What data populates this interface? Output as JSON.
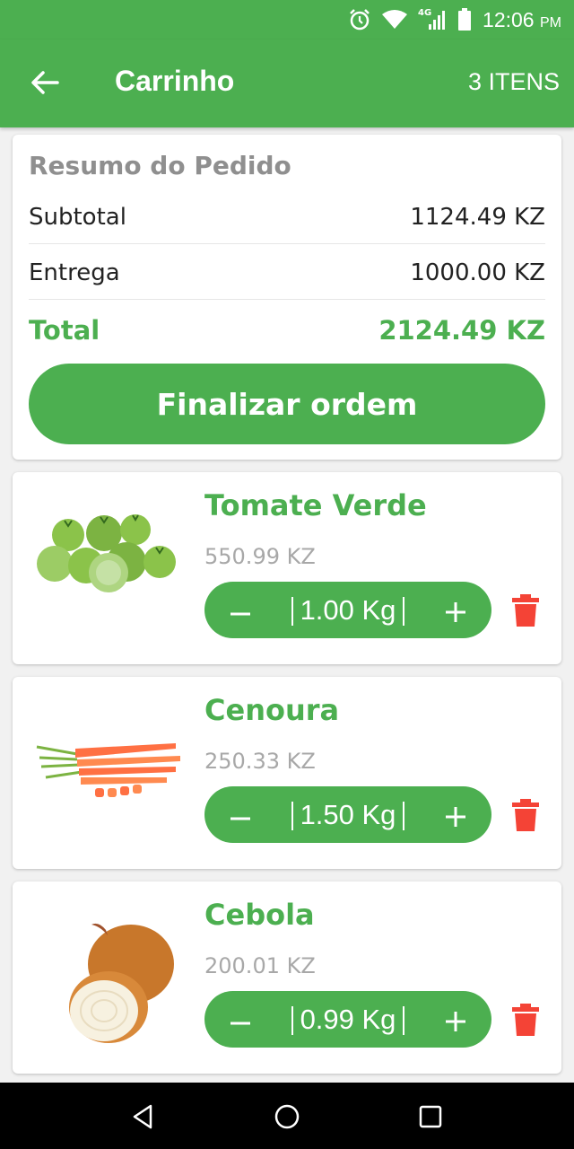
{
  "status_bar": {
    "time": "12:06",
    "ampm": "PM",
    "network": "4G"
  },
  "header": {
    "title": "Carrinho",
    "item_count": "3 ITENS"
  },
  "summary": {
    "title": "Resumo do Pedido",
    "subtotal_label": "Subtotal",
    "subtotal_value": "1124.49 KZ",
    "delivery_label": "Entrega",
    "delivery_value": "1000.00 KZ",
    "total_label": "Total",
    "total_value": "2124.49 KZ",
    "checkout_label": "Finalizar ordem"
  },
  "items": [
    {
      "name": "Tomate Verde",
      "price": "550.99 KZ",
      "quantity": "1.00 Kg"
    },
    {
      "name": "Cenoura",
      "price": "250.33 KZ",
      "quantity": "1.50 Kg"
    },
    {
      "name": "Cebola",
      "price": "200.01 KZ",
      "quantity": "0.99 Kg"
    }
  ],
  "colors": {
    "primary": "#4caf50",
    "delete": "#f44336",
    "muted": "#a8a8a8"
  },
  "icons": [
    "back-arrow-icon",
    "minus-icon",
    "plus-icon",
    "trash-icon",
    "alarm-icon",
    "wifi-icon",
    "signal-icon",
    "battery-icon",
    "nav-back-icon",
    "nav-home-icon",
    "nav-recents-icon"
  ]
}
